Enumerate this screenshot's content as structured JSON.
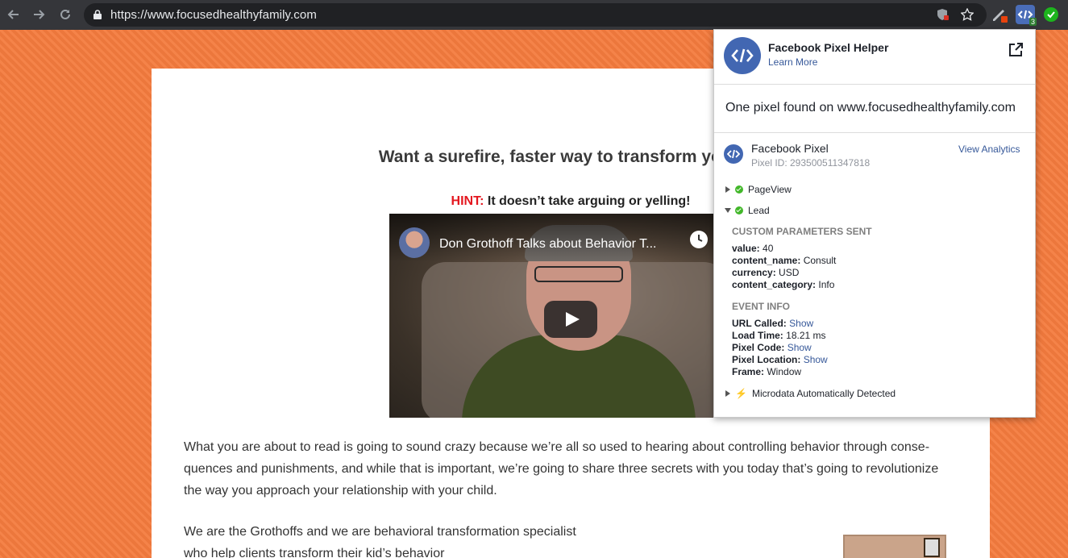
{
  "browser": {
    "url": "https://www.focusedhealthyfamily.com",
    "extension_badge": "3"
  },
  "page": {
    "headline": "Want a surefire, faster way to transform your ch",
    "hint_label": "HINT:",
    "hint_text": "It doesn’t take arguing or yelling!",
    "video_title": "Don Grothoff Talks about Behavior T...",
    "paragraph1_line1": "What you are about to read is going to sound crazy because we’re all so used to hearing about controlling behavior through conse-",
    "paragraph1_line2": "quences and punishments, and while that is important, we’re going to share three secrets with you today that’s going to revolutionize",
    "paragraph1_line3": "the way you approach your relationship with your child.",
    "paragraph2_line1": "We are the Grothoffs and we are behavioral transformation specialist",
    "paragraph2_line2": "who help clients transform their kid’s behavior"
  },
  "popup": {
    "title": "Facebook Pixel Helper",
    "learn_more": "Learn More",
    "summary": "One pixel found on www.focusedhealthyfamily.com",
    "pixel_name": "Facebook Pixel",
    "pixel_id": "Pixel ID: 293500511347818",
    "view_analytics": "View Analytics",
    "events": {
      "pageview": "PageView",
      "lead": "Lead",
      "microdata": "Microdata Automatically Detected"
    },
    "custom_params_heading": "CUSTOM PARAMETERS SENT",
    "custom_params": [
      {
        "key": "value:",
        "val": "40"
      },
      {
        "key": "content_name:",
        "val": "Consult"
      },
      {
        "key": "currency:",
        "val": "USD"
      },
      {
        "key": "content_category:",
        "val": "Info"
      }
    ],
    "event_info_heading": "EVENT INFO",
    "event_info": [
      {
        "key": "URL Called:",
        "val": "Show"
      },
      {
        "key": "Load Time:",
        "val": "18.21 ms"
      },
      {
        "key": "Pixel Code:",
        "val": "Show"
      },
      {
        "key": "Pixel Location:",
        "val": "Show"
      },
      {
        "key": "Frame:",
        "val": "Window"
      }
    ]
  },
  "colors": {
    "page_background": "#f47b3e",
    "facebook_blue": "#4267b2",
    "link": "#365899",
    "hint_red": "#e4171f"
  }
}
